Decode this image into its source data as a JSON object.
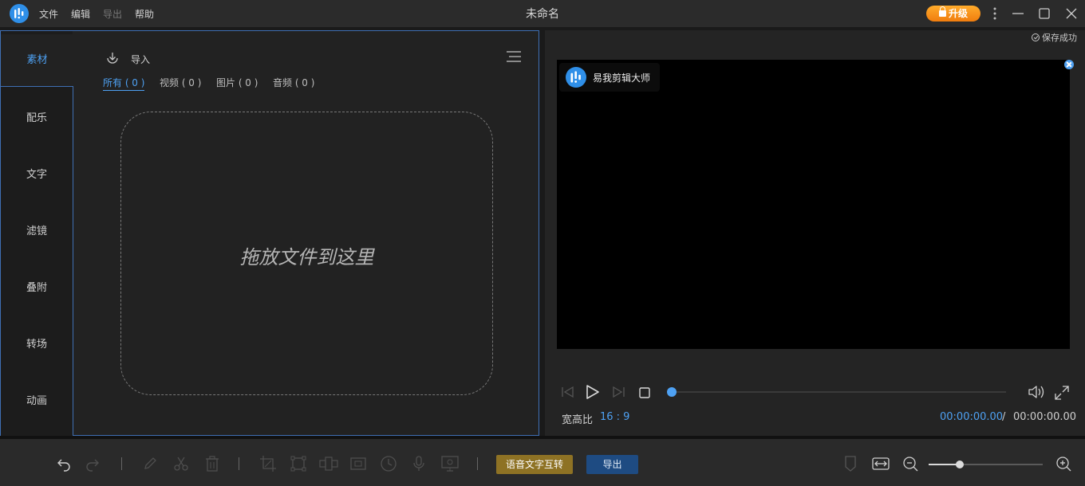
{
  "menu": {
    "file": "文件",
    "edit": "编辑",
    "export": "导出",
    "help": "帮助"
  },
  "window_title": "未命名",
  "upgrade_label": "升级",
  "save_status": "保存成功",
  "side_tabs": {
    "media": "素材",
    "music": "配乐",
    "text": "文字",
    "filters": "滤镜",
    "overlays": "叠附",
    "transitions": "转场",
    "animation": "动画"
  },
  "import_label": "导入",
  "filter_tabs": {
    "all": "所有 ( 0 )",
    "video": "视频 ( 0 )",
    "image": "图片 ( 0 )",
    "audio": "音频 ( 0 )"
  },
  "drop_text": "拖放文件到这里",
  "watermark_text": "易我剪辑大师",
  "player": {
    "aspect_label": "宽高比",
    "aspect_value": "16 : 9",
    "time_current": "00:00:00.00",
    "time_sep": "/",
    "time_total": "00:00:00.00",
    "progress": 0
  },
  "toolbar": {
    "speech_button": "语音文字互转",
    "export_button": "导出",
    "zoom_level": 0.27
  },
  "colors": {
    "accent": "#4ea1f3",
    "upgrade": "#f7941d",
    "speech_button": "#8e7224",
    "export_button": "#1e4b82"
  }
}
